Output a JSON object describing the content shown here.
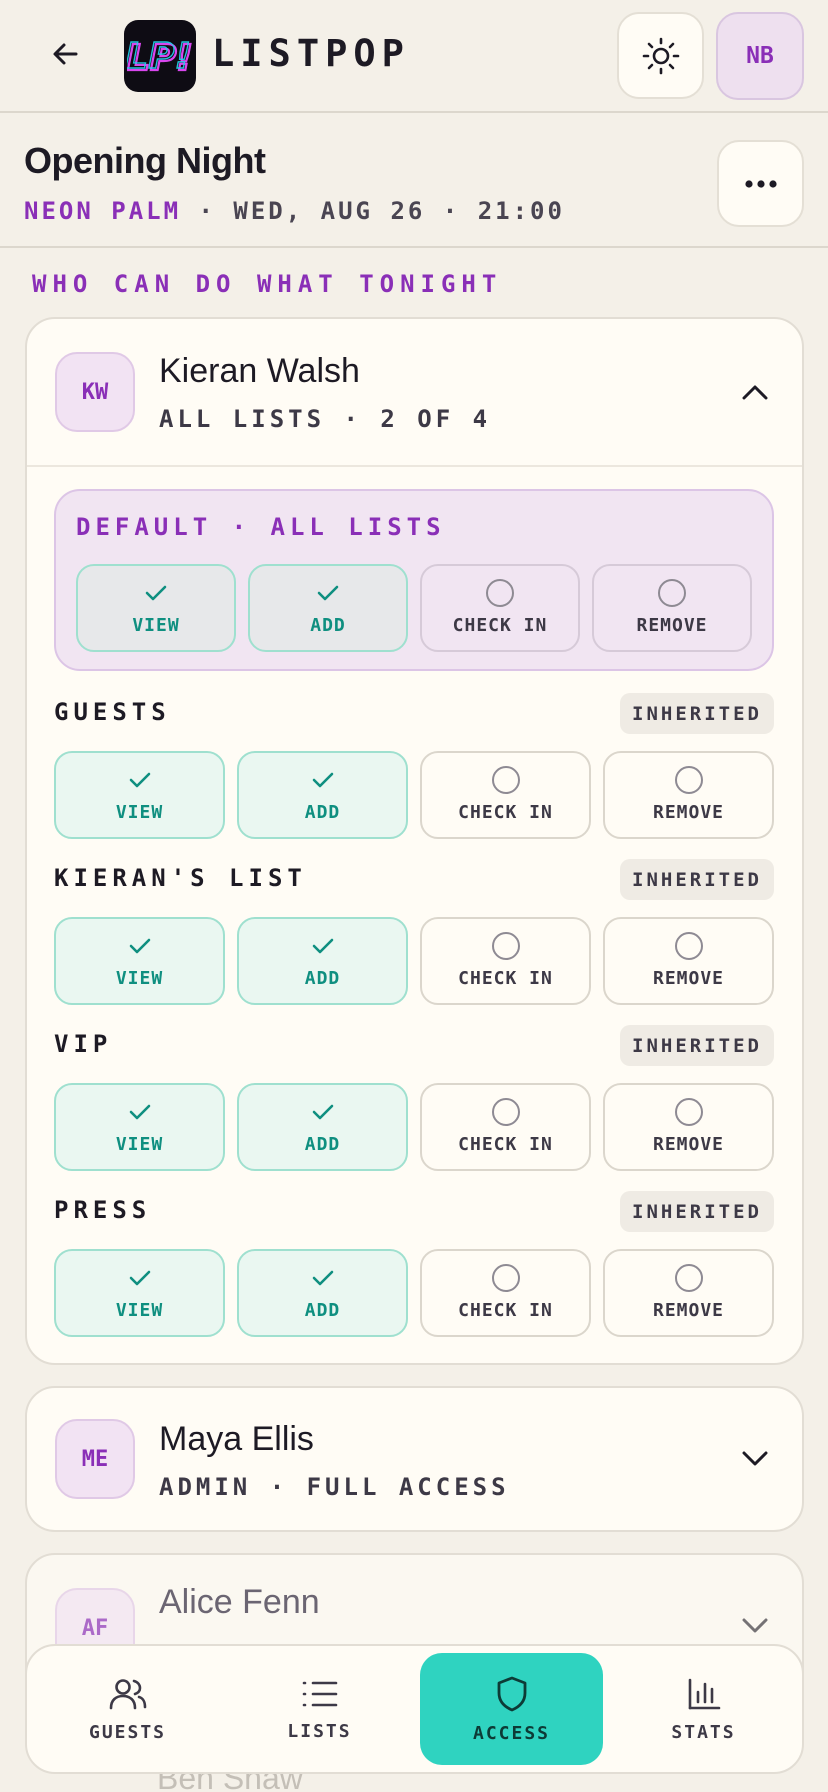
{
  "header": {
    "app_name": "LISTPOP",
    "logo_text": "LP!",
    "user_initials": "NB"
  },
  "event": {
    "title": "Opening Night",
    "venue": "NEON PALM",
    "datetime": "· WED, AUG 26 · 21:00"
  },
  "section_heading": "WHO CAN DO WHAT TONIGHT",
  "member_expanded": {
    "initials": "KW",
    "name": "Kieran Walsh",
    "subtitle": "ALL LISTS · 2 OF 4",
    "default_label": "DEFAULT · ALL LISTS",
    "default_perms": [
      {
        "label": "VIEW",
        "on": true
      },
      {
        "label": "ADD",
        "on": true
      },
      {
        "label": "CHECK IN",
        "on": false
      },
      {
        "label": "REMOVE",
        "on": false
      }
    ],
    "lists": [
      {
        "name": "GUESTS",
        "badge": "INHERITED",
        "perms": [
          {
            "label": "VIEW",
            "on": true
          },
          {
            "label": "ADD",
            "on": true
          },
          {
            "label": "CHECK IN",
            "on": false
          },
          {
            "label": "REMOVE",
            "on": false
          }
        ]
      },
      {
        "name": "KIERAN'S LIST",
        "badge": "INHERITED",
        "perms": [
          {
            "label": "VIEW",
            "on": true
          },
          {
            "label": "ADD",
            "on": true
          },
          {
            "label": "CHECK IN",
            "on": false
          },
          {
            "label": "REMOVE",
            "on": false
          }
        ]
      },
      {
        "name": "VIP",
        "badge": "INHERITED",
        "perms": [
          {
            "label": "VIEW",
            "on": true
          },
          {
            "label": "ADD",
            "on": true
          },
          {
            "label": "CHECK IN",
            "on": false
          },
          {
            "label": "REMOVE",
            "on": false
          }
        ]
      },
      {
        "name": "PRESS",
        "badge": "INHERITED",
        "perms": [
          {
            "label": "VIEW",
            "on": true
          },
          {
            "label": "ADD",
            "on": true
          },
          {
            "label": "CHECK IN",
            "on": false
          },
          {
            "label": "REMOVE",
            "on": false
          }
        ]
      }
    ]
  },
  "member_maya": {
    "initials": "ME",
    "name": "Maya Ellis",
    "subtitle": "ADMIN · FULL ACCESS"
  },
  "member_alice": {
    "initials": "AF",
    "name": "Alice Fenn"
  },
  "member_below_partial": "Ben Shaw",
  "nav": {
    "guests": "GUESTS",
    "lists": "LISTS",
    "access": "ACCESS",
    "stats": "STATS"
  },
  "colors": {
    "accent_purple": "#8a2fb7",
    "accent_teal": "#2fd3c0",
    "granted_green": "#0f8f80",
    "background": "#f4f0e8"
  }
}
